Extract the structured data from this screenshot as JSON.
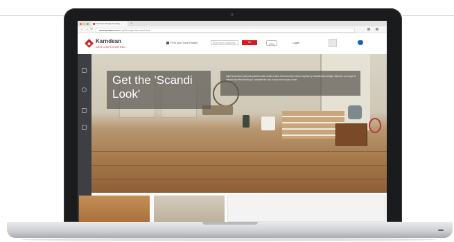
{
  "browser": {
    "tab_title": "Karndean Design Flooring",
    "new_tab": "+",
    "url_host": "www.karndean.com",
    "url_path": "/en-gb/floors/get-the-scandi-look"
  },
  "site": {
    "logo_name": "Karndean",
    "logo_sub": "DESIGNFLOORING",
    "store_finder": "Find your local retailer",
    "postcode_placeholder": "Enter town, postcode",
    "go_label": "Go",
    "login_label": "Login"
  },
  "hero": {
    "title": "Get the 'Scandi Look'",
    "description": "Light wood floors and pale painted walls create a calm, fresh and airy interior inspired by Scandinavian design. Discover our range of natural oak effect flooring to complete the look in any room of your home.",
    "slides": 3,
    "active_slide": 2
  },
  "colors": {
    "brand_red": "#d71920",
    "accent_blue": "#1e5fb3"
  }
}
